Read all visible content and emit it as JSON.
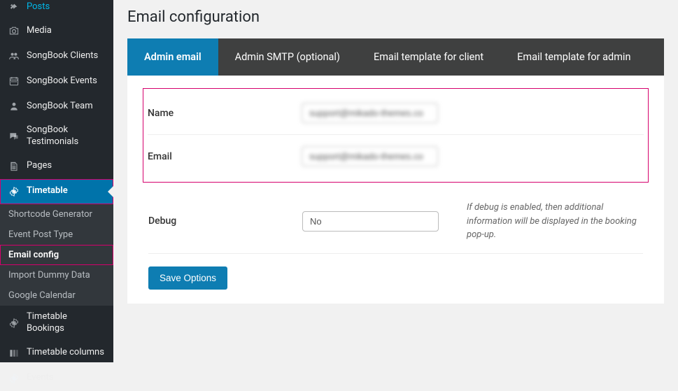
{
  "sidebar": {
    "items": [
      {
        "label": "Posts",
        "icon": "pin"
      },
      {
        "label": "Media",
        "icon": "camera"
      },
      {
        "label": "SongBook Clients",
        "icon": "users"
      },
      {
        "label": "SongBook Events",
        "icon": "calendar"
      },
      {
        "label": "SongBook Team",
        "icon": "person"
      },
      {
        "label": "SongBook Testimonials",
        "icon": "comments"
      },
      {
        "label": "Pages",
        "icon": "page"
      },
      {
        "label": "Timetable",
        "icon": "gear"
      },
      {
        "label": "Timetable Bookings",
        "icon": "gear"
      },
      {
        "label": "Timetable columns",
        "icon": "columns"
      },
      {
        "label": "Events",
        "icon": "gear"
      }
    ],
    "sub_items": [
      {
        "label": "Shortcode Generator"
      },
      {
        "label": "Event Post Type"
      },
      {
        "label": "Email config"
      },
      {
        "label": "Import Dummy Data"
      },
      {
        "label": "Google Calendar"
      }
    ]
  },
  "page": {
    "title": "Email configuration"
  },
  "tabs": [
    {
      "label": "Admin email"
    },
    {
      "label": "Admin SMTP (optional)"
    },
    {
      "label": "Email template for client"
    },
    {
      "label": "Email template for admin"
    }
  ],
  "form": {
    "name_label": "Name",
    "name_value": "support@mikado-themes.co",
    "email_label": "Email",
    "email_value": "support@mikado-themes.co",
    "debug_label": "Debug",
    "debug_value": "No",
    "debug_desc": "If debug is enabled, then additional information will be displayed in the booking pop-up.",
    "save_label": "Save Options"
  }
}
